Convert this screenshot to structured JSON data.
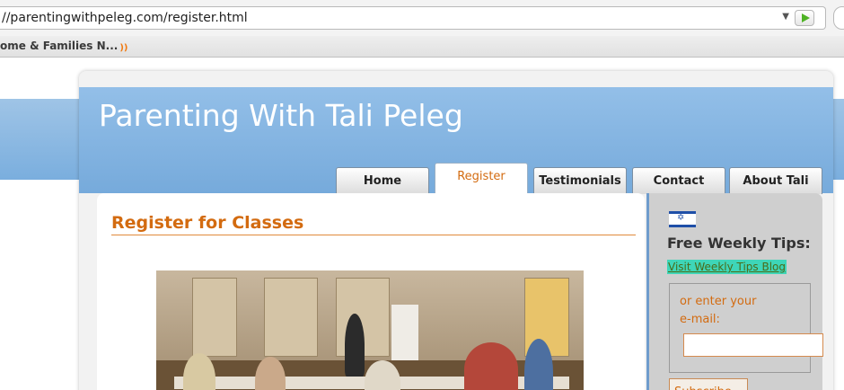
{
  "browser": {
    "url": "//parentingwithpeleg.com/register.html",
    "bookmark": "ome & Families N..."
  },
  "site": {
    "title": "Parenting With Tali Peleg",
    "nav": [
      {
        "label": "Home"
      },
      {
        "label": "Register"
      },
      {
        "label": "Testimonials"
      },
      {
        "label": "Contact"
      },
      {
        "label": "About Tali"
      }
    ],
    "active_tab": "Register"
  },
  "content": {
    "heading": "Register for Classes"
  },
  "sidebar": {
    "tips_heading": "Free Weekly Tips:",
    "tips_link": "Visit Weekly Tips Blog",
    "email_label": "or enter your e-mail:",
    "email_value": "",
    "subscribe_label": "Subscribe"
  },
  "colors": {
    "accent": "#d36b10",
    "header_blue": "#7aaede",
    "link_highlight": "#3ed6b8"
  }
}
